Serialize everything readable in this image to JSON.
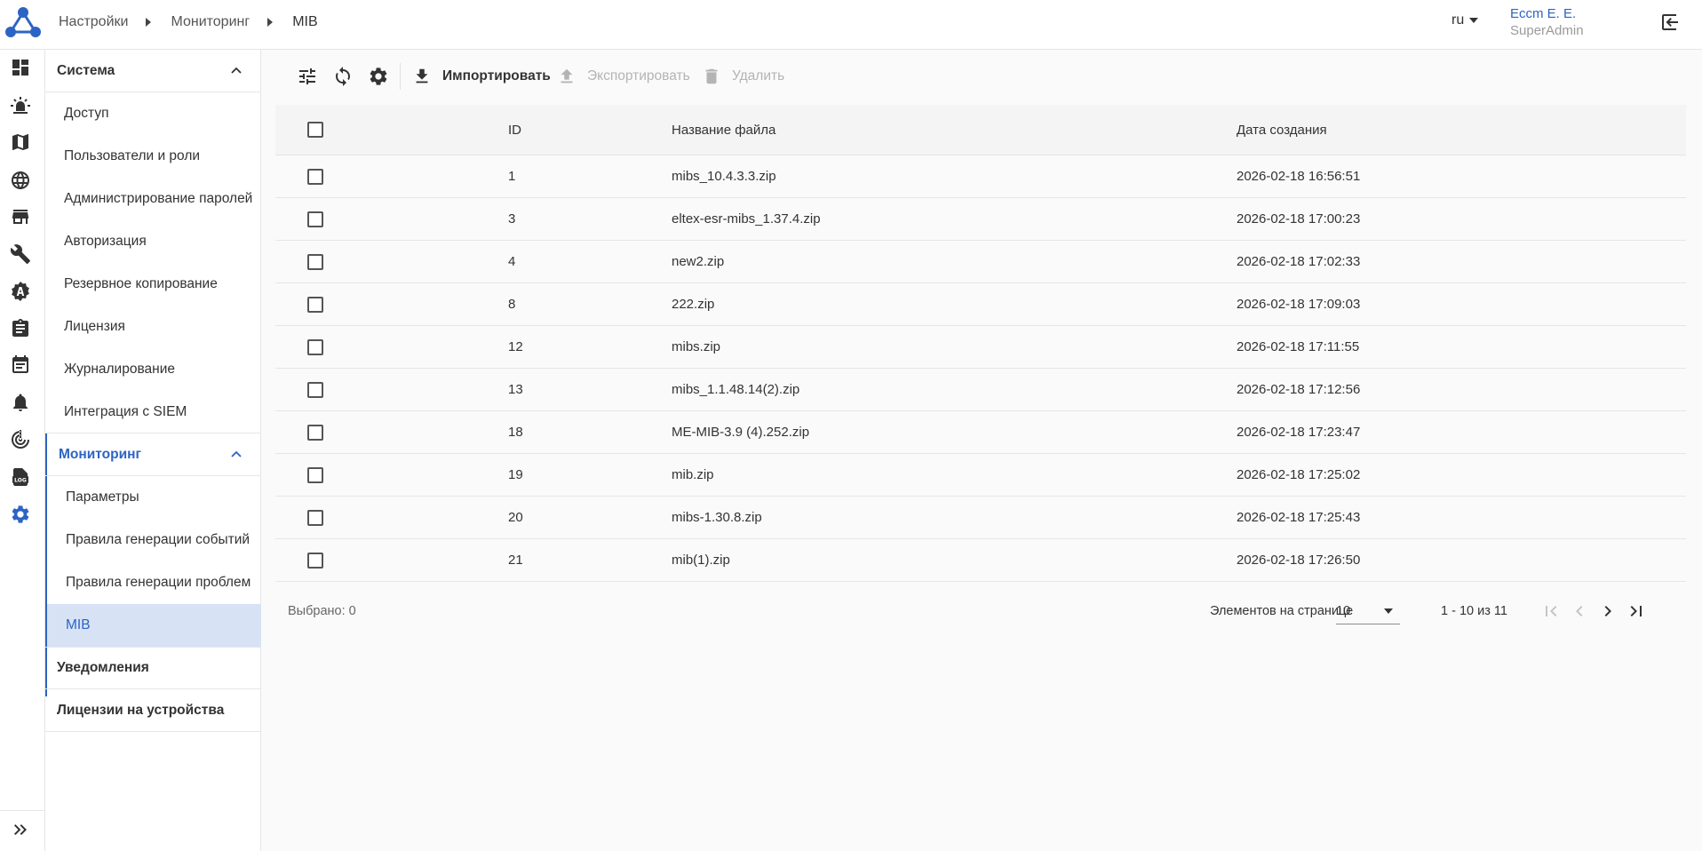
{
  "breadcrumb": {
    "items": [
      "Настройки",
      "Мониторинг",
      "MIB"
    ]
  },
  "header": {
    "language": "ru",
    "user_name": "Eccm E. E.",
    "user_role": "SuperAdmin"
  },
  "rail": {
    "icons": [
      "dashboard-icon",
      "alarm-icon",
      "map-icon",
      "globe-icon",
      "store-icon",
      "wrench-icon",
      "auto-badge-icon",
      "clipboard-icon",
      "event-calendar-icon",
      "bell-icon",
      "radar-icon",
      "log-icon",
      "gear-icon"
    ],
    "active": "gear-icon"
  },
  "sidebar": {
    "system_label": "Система",
    "system_items": [
      "Доступ",
      "Пользователи и роли",
      "Администрирование паролей",
      "Авторизация",
      "Резервное копирование",
      "Лицензия",
      "Журналирование",
      "Интеграция с SIEM"
    ],
    "monitoring_label": "Мониторинг",
    "monitoring_items": [
      "Параметры",
      "Правила генерации событий",
      "Правила генерации проблем",
      "MIB"
    ],
    "notifications_label": "Уведомления",
    "device_licenses_label": "Лицензии на устройства"
  },
  "toolbar": {
    "import_label": "Импортировать",
    "export_label": "Экспортировать",
    "delete_label": "Удалить"
  },
  "table": {
    "columns": {
      "id": "ID",
      "name": "Название файла",
      "date": "Дата создания"
    },
    "rows": [
      {
        "id": "1",
        "name": "mibs_10.4.3.3.zip",
        "date": "2026-02-18 16:56:51"
      },
      {
        "id": "3",
        "name": "eltex-esr-mibs_1.37.4.zip",
        "date": "2026-02-18 17:00:23"
      },
      {
        "id": "4",
        "name": "new2.zip",
        "date": "2026-02-18 17:02:33"
      },
      {
        "id": "8",
        "name": "222.zip",
        "date": "2026-02-18 17:09:03"
      },
      {
        "id": "12",
        "name": "mibs.zip",
        "date": "2026-02-18 17:11:55"
      },
      {
        "id": "13",
        "name": "mibs_1.1.48.14(2).zip",
        "date": "2026-02-18 17:12:56"
      },
      {
        "id": "18",
        "name": "ME-MIB-3.9 (4).252.zip",
        "date": "2026-02-18 17:23:47"
      },
      {
        "id": "19",
        "name": "mib.zip",
        "date": "2026-02-18 17:25:02"
      },
      {
        "id": "20",
        "name": "mibs-1.30.8.zip",
        "date": "2026-02-18 17:25:43"
      },
      {
        "id": "21",
        "name": "mib(1).zip",
        "date": "2026-02-18 17:26:50"
      }
    ]
  },
  "footer": {
    "selected": "Выбрано: 0",
    "per_page_label": "Элементов на странице",
    "per_page_value": "10",
    "range": "1 - 10 из 11"
  },
  "colors": {
    "accent": "#2c64c4",
    "active_bg": "#d7e2f4"
  }
}
